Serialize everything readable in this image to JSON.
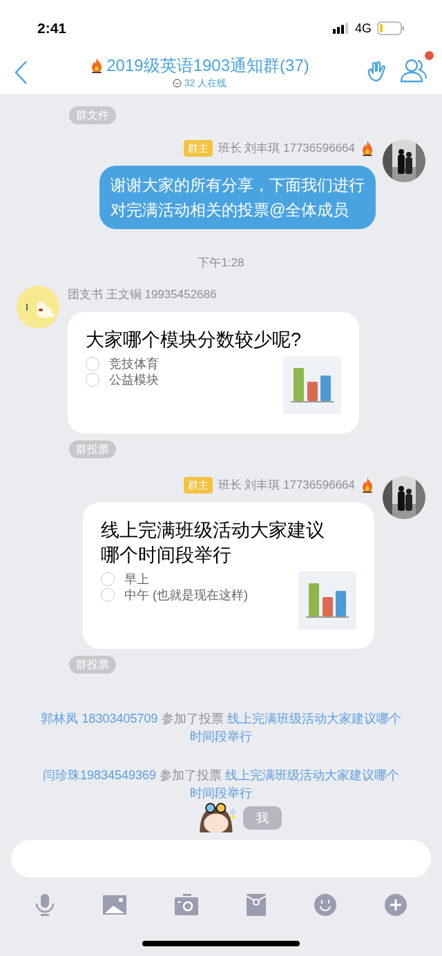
{
  "status_bar": {
    "time": "2:41",
    "network": "4G"
  },
  "header": {
    "title": "2019级英语1903通知群(37)",
    "online": "32 人在线",
    "notification_dot": true
  },
  "messages": [
    {
      "kind": "tag",
      "text": "群文件"
    },
    {
      "kind": "text",
      "outgoing": true,
      "badge": "群主",
      "sender": "班长 刘丰琪 17736596664",
      "lines": [
        "谢谢大家的所有分享，下面我们进行",
        "对完满活动相关的投票@全体成员"
      ]
    },
    {
      "kind": "time",
      "text": "下午1:28"
    },
    {
      "kind": "poll",
      "outgoing": false,
      "sender": "团支书 王文铜 19935452686",
      "question": [
        "大家哪个模块分数较少呢?"
      ],
      "options": [
        {
          "label": "竞技体育",
          "selected": false
        },
        {
          "label": "公益模块",
          "selected": false
        }
      ]
    },
    {
      "kind": "tag",
      "text": "群投票"
    },
    {
      "kind": "poll",
      "outgoing": true,
      "badge": "群主",
      "sender": "班长 刘丰琪 17736596664",
      "question": [
        "线上完满班级活动大家建议",
        "哪个时间段举行"
      ],
      "options": [
        {
          "label": "早上",
          "selected": false
        },
        {
          "label": "中午 (也就是现在这样)",
          "selected": false
        }
      ]
    },
    {
      "kind": "tag",
      "text": "群投票"
    },
    {
      "kind": "notice",
      "name": "郭林凤 18303405709",
      "action": "参加了投票",
      "link": "线上完满班级活动大家建议哪个时间段举行"
    },
    {
      "kind": "notice",
      "name": "闫珍珠19834549369",
      "action": "参加了投票",
      "link": "线上完满班级活动大家建议哪个时间段举行"
    }
  ],
  "pendant": {
    "label": "我"
  }
}
